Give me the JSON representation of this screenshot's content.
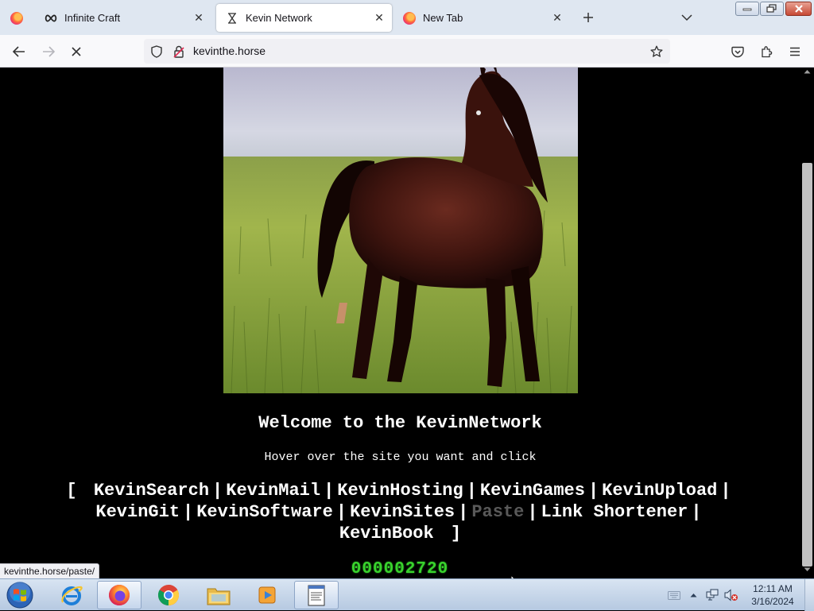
{
  "browser": {
    "tabs": [
      {
        "title": "Infinite Craft",
        "icon": "infinity-icon",
        "active": false
      },
      {
        "title": "Kevin Network",
        "icon": "hourglass-icon",
        "active": true
      },
      {
        "title": "New Tab",
        "icon": "firefox-icon",
        "active": false
      }
    ],
    "url": "kevinthe.horse",
    "status_link": "kevinthe.horse/paste/"
  },
  "page": {
    "welcome": "Welcome to the KevinNetwork",
    "hint": "Hover over the site you want and click",
    "bracket_open": "[",
    "bracket_close": "]",
    "separator": "|",
    "links": [
      {
        "label": "KevinSearch",
        "hovered": false
      },
      {
        "label": "KevinMail",
        "hovered": false
      },
      {
        "label": "KevinHosting",
        "hovered": false
      },
      {
        "label": "KevinGames",
        "hovered": false
      },
      {
        "label": "KevinUpload",
        "hovered": false
      },
      {
        "label": "KevinGit",
        "hovered": false
      },
      {
        "label": "KevinSoftware",
        "hovered": false
      },
      {
        "label": "KevinSites",
        "hovered": false
      },
      {
        "label": "Paste",
        "hovered": true
      },
      {
        "label": "Link Shortener",
        "hovered": false
      },
      {
        "label": "KevinBook",
        "hovered": false
      }
    ],
    "visitor_counter": "000002720",
    "counter_color": "#39d32d",
    "hover_link_color": "#595959"
  },
  "taskbar": {
    "items": [
      "start-orb-icon",
      "internet-explorer-icon",
      "firefox-icon",
      "chrome-icon",
      "file-explorer-icon",
      "media-player-icon",
      "notepad-icon"
    ],
    "clock_time": "12:11 AM",
    "clock_date": "3/16/2024"
  }
}
